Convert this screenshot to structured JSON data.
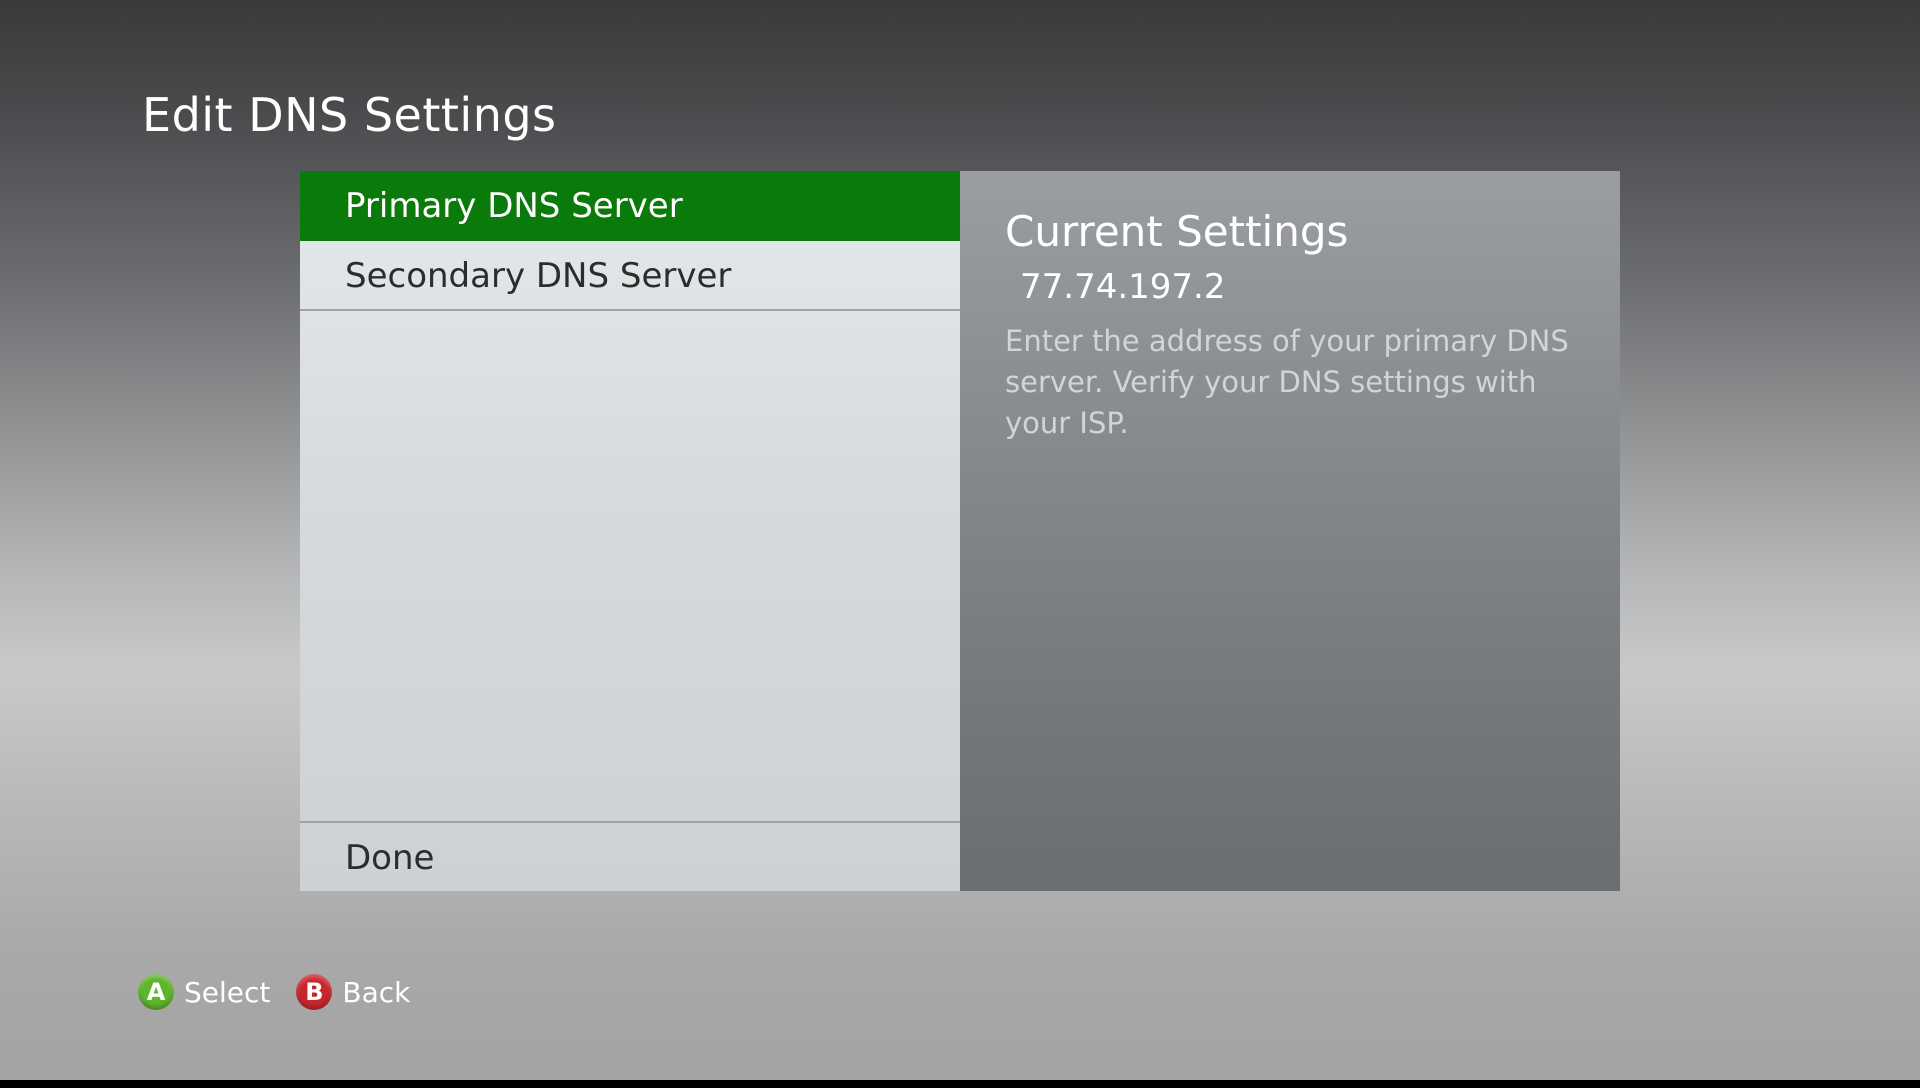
{
  "page": {
    "title": "Edit DNS Settings"
  },
  "menu": {
    "items": [
      {
        "label": "Primary DNS Server",
        "selected": true
      },
      {
        "label": "Secondary DNS Server",
        "selected": false
      }
    ],
    "done_label": "Done"
  },
  "info": {
    "heading": "Current Settings",
    "value": "77.74.197.2",
    "description": "Enter the address of your primary DNS server. Verify your DNS settings with your ISP."
  },
  "hints": {
    "a": {
      "glyph": "A",
      "label": "Select",
      "color": "#5fb52b"
    },
    "b": {
      "glyph": "B",
      "label": "Back",
      "color": "#c8262c"
    }
  },
  "colors": {
    "selection_green": "#0a7a0a"
  }
}
